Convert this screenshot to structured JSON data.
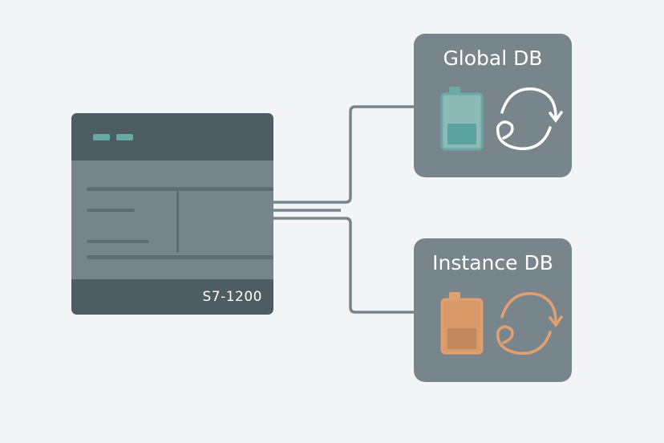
{
  "plc": {
    "model": "S7-1200"
  },
  "global_db": {
    "title": "Global DB",
    "accent": "#6aa9a6",
    "icons": [
      "battery-icon",
      "cycle-icon"
    ]
  },
  "instance_db": {
    "title": "Instance DB",
    "accent": "#e0a070",
    "icons": [
      "battery-icon",
      "cycle-icon"
    ]
  },
  "colors": {
    "background": "#f2f4f6",
    "panel": "#78858b",
    "panel_dark": "#4e5d62",
    "connector": "#78858b"
  }
}
